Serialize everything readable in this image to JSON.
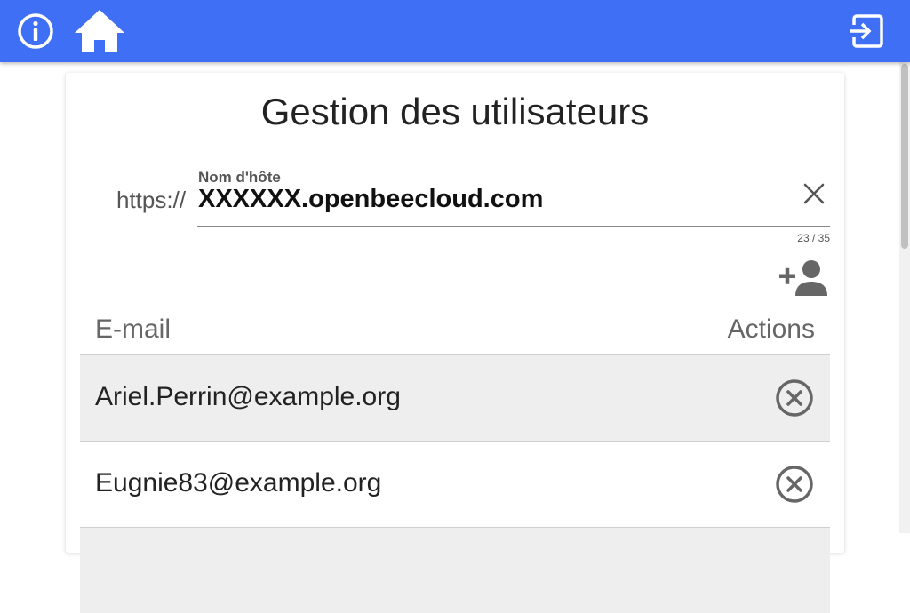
{
  "header": {
    "info_icon": "info-circle-icon",
    "home_icon": "home-icon",
    "logout_icon": "exit-to-app-icon",
    "background": "#3f6ff5"
  },
  "page": {
    "title": "Gestion des utilisateurs"
  },
  "hostname": {
    "prefix": "https://",
    "label": "Nom d'hôte",
    "value": "XXXXXX.openbeecloud.com",
    "counter": "23 / 35",
    "clear_icon": "close-icon"
  },
  "add_user_icon": "person-add-icon",
  "table": {
    "columns": [
      "E-mail",
      "Actions"
    ],
    "rows": [
      {
        "email": "Ariel.Perrin@example.org",
        "action_icon": "remove-circle-x-icon"
      },
      {
        "email": "Eugnie83@example.org",
        "action_icon": "remove-circle-x-icon"
      }
    ]
  }
}
